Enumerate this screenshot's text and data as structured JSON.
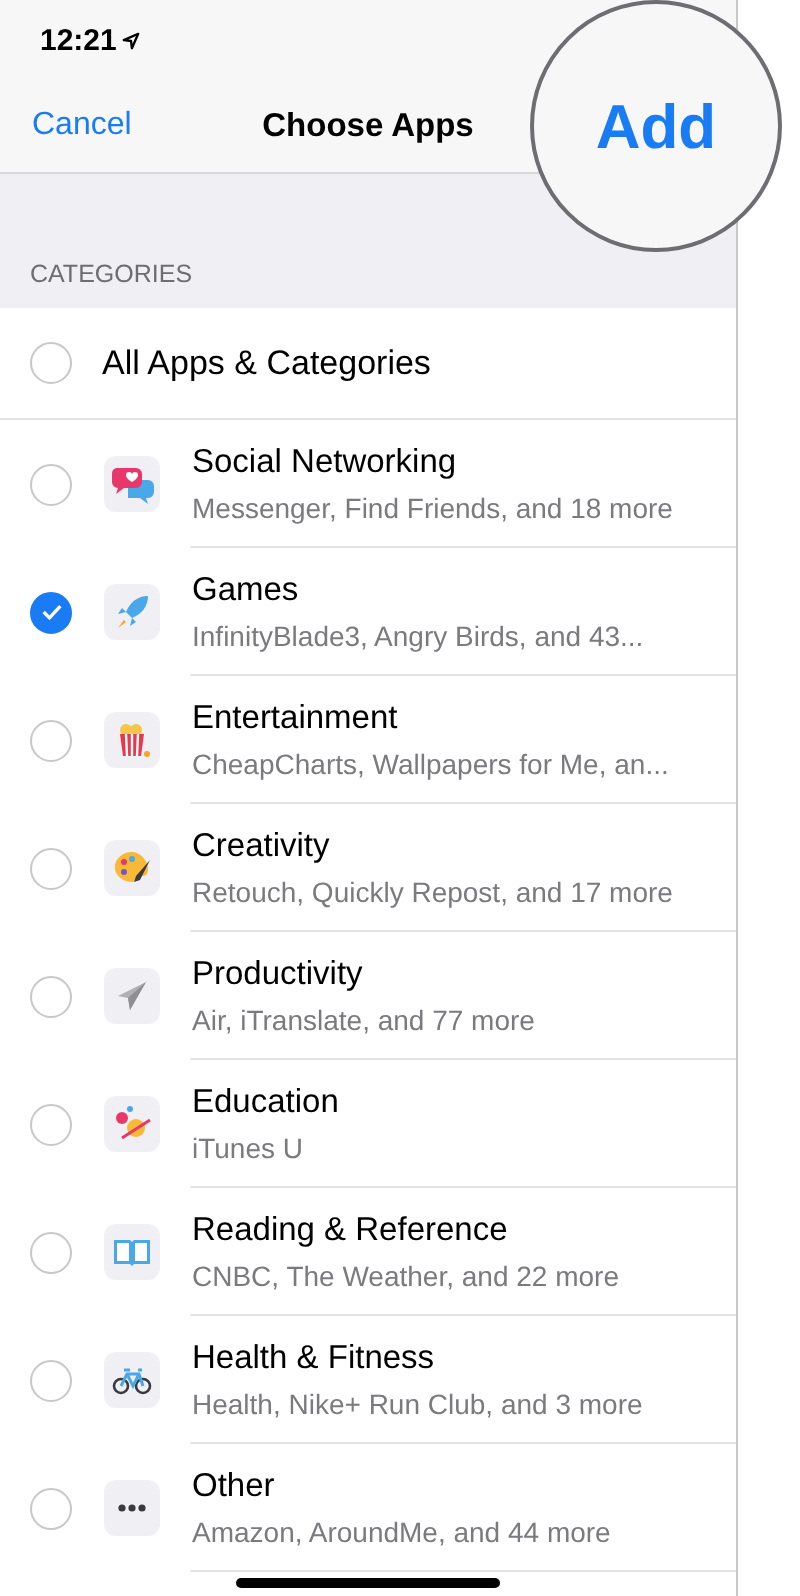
{
  "status_bar": {
    "time": "12:21"
  },
  "nav": {
    "cancel": "Cancel",
    "title": "Choose Apps",
    "confirm": "Add"
  },
  "section_header": "CATEGORIES",
  "all_option": {
    "label": "All Apps & Categories",
    "selected": false
  },
  "categories": [
    {
      "kind": "social",
      "name": "Social Networking",
      "apps": "Messenger, Find Friends, and 18 more",
      "selected": false
    },
    {
      "kind": "games",
      "name": "Games",
      "apps": "InfinityBlade3, Angry Birds, and 43...",
      "selected": true
    },
    {
      "kind": "entertainment",
      "name": "Entertainment",
      "apps": "CheapCharts, Wallpapers for Me, an...",
      "selected": false
    },
    {
      "kind": "creativity",
      "name": "Creativity",
      "apps": "Retouch, Quickly Repost, and 17 more",
      "selected": false
    },
    {
      "kind": "productivity",
      "name": "Productivity",
      "apps": "Air, iTranslate, and 77 more",
      "selected": false
    },
    {
      "kind": "education",
      "name": "Education",
      "apps": "iTunes U",
      "selected": false
    },
    {
      "kind": "reading",
      "name": "Reading & Reference",
      "apps": "CNBC, The Weather, and 22 more",
      "selected": false
    },
    {
      "kind": "health",
      "name": "Health & Fitness",
      "apps": "Health, Nike+ Run Club, and 3 more",
      "selected": false
    },
    {
      "kind": "other",
      "name": "Other",
      "apps": "Amazon, AroundMe, and 44 more",
      "selected": false
    }
  ]
}
